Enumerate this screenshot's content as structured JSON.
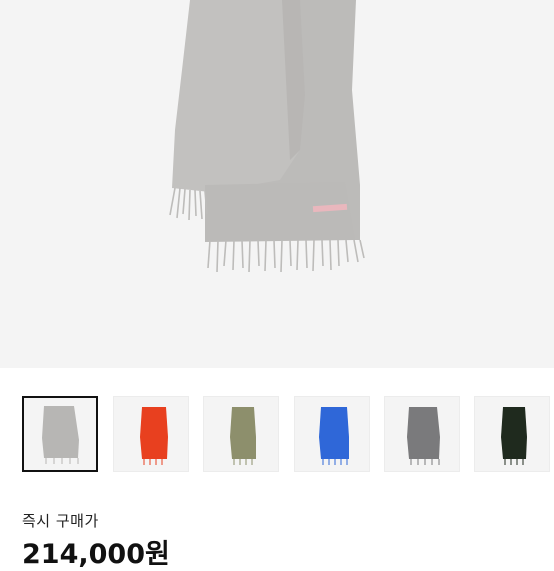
{
  "product": {
    "main_image": "gray-scarf-photo",
    "main_color": "#b9b8b6"
  },
  "thumbnails": [
    {
      "name": "gray",
      "color": "#b7b6b4",
      "selected": true
    },
    {
      "name": "red",
      "color": "#e8401f",
      "selected": false
    },
    {
      "name": "olive",
      "color": "#8d8f6c",
      "selected": false
    },
    {
      "name": "blue",
      "color": "#2f67d8",
      "selected": false
    },
    {
      "name": "dark-gray",
      "color": "#7a7a7c",
      "selected": false
    },
    {
      "name": "black-green",
      "color": "#1f2a1e",
      "selected": false
    }
  ],
  "purchase": {
    "label": "즉시 구매가",
    "price": "214,000원"
  }
}
